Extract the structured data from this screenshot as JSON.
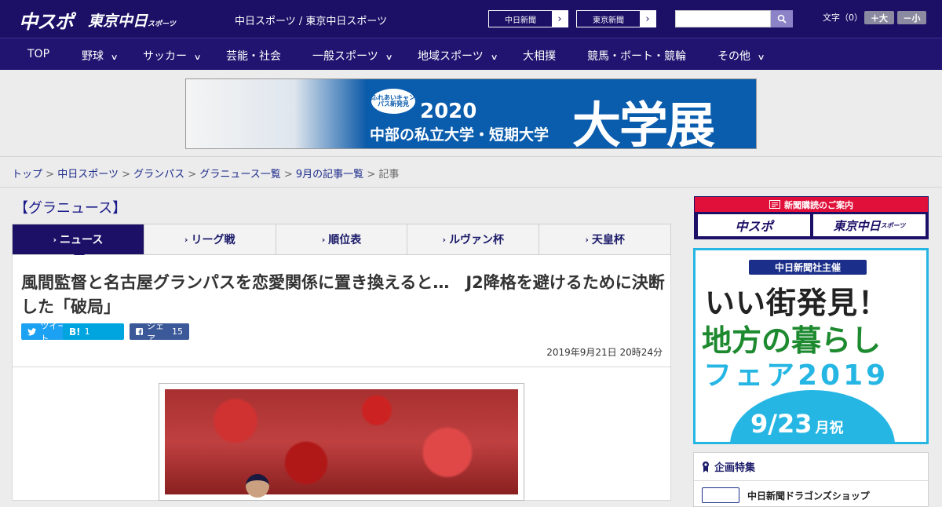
{
  "header": {
    "logo_chunichi": "中スポ",
    "logo_tokyo": "東京中日",
    "logo_tokyo_small": "スポーツ",
    "site_name": "中日スポーツ / 東京中日スポーツ",
    "paper_links": [
      {
        "label": "中日新聞"
      },
      {
        "label": "東京新聞"
      }
    ],
    "search_placeholder": "",
    "font_size_label": "文字（0）",
    "font_larger": "＋大",
    "font_smaller": "－小"
  },
  "nav": {
    "items": [
      {
        "label": "TOP",
        "has_menu": false
      },
      {
        "label": "野球",
        "has_menu": true
      },
      {
        "label": "サッカー",
        "has_menu": true
      },
      {
        "label": "芸能・社会",
        "has_menu": false
      },
      {
        "label": "一般スポーツ",
        "has_menu": true
      },
      {
        "label": "地域スポーツ",
        "has_menu": true
      },
      {
        "label": "大相撲",
        "has_menu": false
      },
      {
        "label": "競馬・ボート・競輪",
        "has_menu": false
      },
      {
        "label": "その他",
        "has_menu": true
      }
    ]
  },
  "banner": {
    "badge": "ふれあいキャンパス新発見",
    "year": "2020",
    "subtitle": "中部の私立大学・短期大学",
    "headline": "大学展"
  },
  "breadcrumb": {
    "items": [
      "トップ",
      "中日スポーツ",
      "グランパス",
      "グラニュース一覧",
      "9月の記事一覧"
    ],
    "current": "記事",
    "separator": ">"
  },
  "section_title": "【グラニュース】",
  "tabs": [
    {
      "label": "ニュース",
      "active": true
    },
    {
      "label": "リーグ戦",
      "active": false
    },
    {
      "label": "順位表",
      "active": false
    },
    {
      "label": "ルヴァン杯",
      "active": false
    },
    {
      "label": "天皇杯",
      "active": false
    }
  ],
  "article": {
    "title": "風間監督と名古屋グランパスを恋愛関係に置き換えると…　J2降格を避けるために決断した「破局」",
    "share": {
      "tweet_label": "ツイート",
      "hatena_label": "B!",
      "hatena_count": "1",
      "facebook_label": "シェア",
      "facebook_count": "15"
    },
    "date": "2019年9月21日 20時24分"
  },
  "sidebar": {
    "subscribe_header": "新聞購読のご案内",
    "subscribe_buttons": [
      "中スポ",
      "東京中日"
    ],
    "subscribe_small": "スポーツ",
    "fair_ad": {
      "organizer": "中日新聞社主催",
      "line1": "いい街発見！",
      "line2": "地方の暮らし",
      "line3": "フェア2019",
      "date": "9/23",
      "day": "月祝"
    },
    "features_title": "企画特集",
    "features_item": "中日新聞ドラゴンズショップ"
  },
  "colors": {
    "brand": "#1b0f66",
    "accent_red": "#e0103a",
    "ad_cyan": "#26b6e3",
    "twitter": "#1da1f2",
    "hatena": "#00a4de",
    "facebook": "#3b5998"
  }
}
